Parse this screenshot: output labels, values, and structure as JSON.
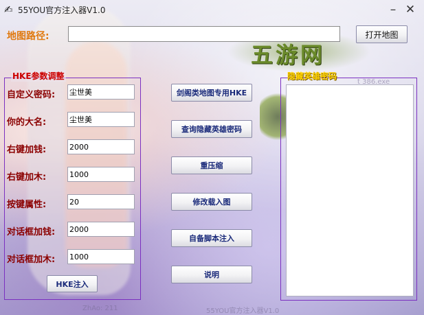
{
  "window": {
    "title": "55YOU官方注入器V1.0",
    "minimize_label": "–",
    "close_label": "✕"
  },
  "map": {
    "label": "地图路径:",
    "path_value": "",
    "open_button": "打开地图"
  },
  "logo_text": "五游网",
  "hke_group": {
    "title": "HKE参数调整",
    "fields": [
      {
        "label": "自定义密码:",
        "value": "尘世美"
      },
      {
        "label": "你的大名:",
        "value": "尘世美"
      },
      {
        "label": "右键加钱:",
        "value": "2000"
      },
      {
        "label": "右键加木:",
        "value": "1000"
      },
      {
        "label": "按键属性:",
        "value": "20"
      },
      {
        "label": "对话框加钱:",
        "value": "2000"
      },
      {
        "label": "对话框加木:",
        "value": "1000"
      }
    ],
    "inject_button": "HKE注入"
  },
  "actions": [
    "剑阁类地图专用HKE",
    "查询隐藏英雄密码",
    "重压缩",
    "修改载入图",
    "自备脚本注入",
    "说明"
  ],
  "hidden_hero": {
    "title": "隐藏英雄密码",
    "content": ""
  },
  "watermarks": {
    "bottom_left": "ZhAo: 211",
    "bottom_center": "55YOU官方注入器V1.0",
    "right_top": "t 386.exe"
  }
}
